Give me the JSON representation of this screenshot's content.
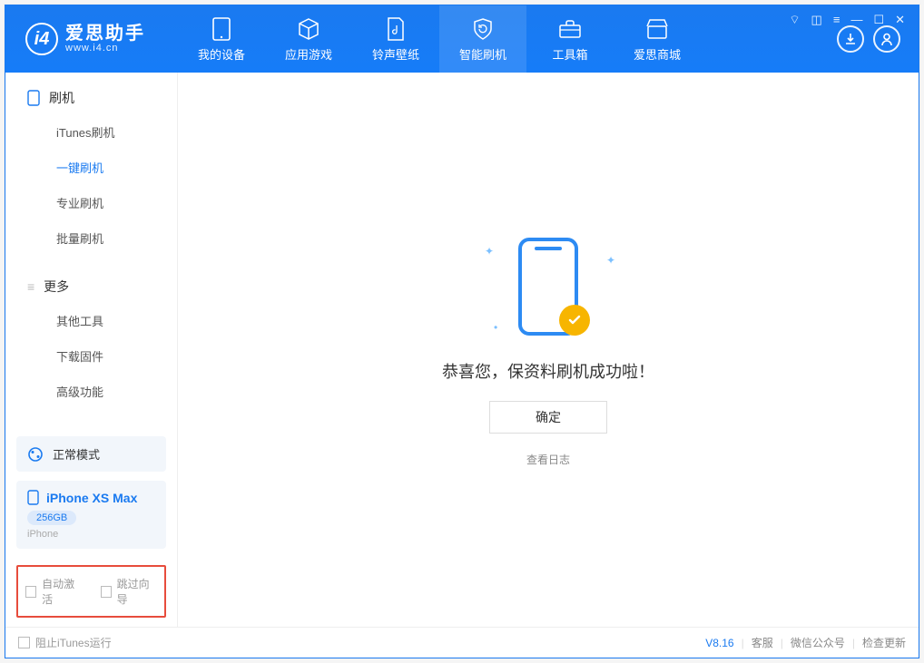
{
  "app": {
    "title": "爱思助手",
    "subtitle": "www.i4.cn"
  },
  "nav": {
    "items": [
      {
        "label": "我的设备",
        "icon": "device"
      },
      {
        "label": "应用游戏",
        "icon": "cube"
      },
      {
        "label": "铃声壁纸",
        "icon": "music"
      },
      {
        "label": "智能刷机",
        "icon": "refresh",
        "active": true
      },
      {
        "label": "工具箱",
        "icon": "toolbox"
      },
      {
        "label": "爱思商城",
        "icon": "shop"
      }
    ]
  },
  "titlebar_icons": [
    "t-shirt",
    "window",
    "menu",
    "min",
    "max",
    "close"
  ],
  "header_round": [
    "download",
    "user"
  ],
  "sidebar": {
    "groups": [
      {
        "label": "刷机",
        "icon": "phone",
        "items": [
          {
            "label": "iTunes刷机"
          },
          {
            "label": "一键刷机",
            "active": true
          },
          {
            "label": "专业刷机"
          },
          {
            "label": "批量刷机"
          }
        ]
      },
      {
        "label": "更多",
        "icon": "menu",
        "items": [
          {
            "label": "其他工具"
          },
          {
            "label": "下载固件"
          },
          {
            "label": "高级功能"
          }
        ]
      }
    ],
    "mode": {
      "label": "正常模式"
    },
    "device": {
      "name": "iPhone XS Max",
      "capacity": "256GB",
      "type": "iPhone"
    },
    "options": [
      {
        "label": "自动激活",
        "checked": false
      },
      {
        "label": "跳过向导",
        "checked": false
      }
    ]
  },
  "main": {
    "message": "恭喜您，保资料刷机成功啦！",
    "ok_label": "确定",
    "log_link": "查看日志"
  },
  "status": {
    "left_checkbox": "阻止iTunes运行",
    "version": "V8.16",
    "links": [
      "客服",
      "微信公众号",
      "检查更新"
    ]
  }
}
